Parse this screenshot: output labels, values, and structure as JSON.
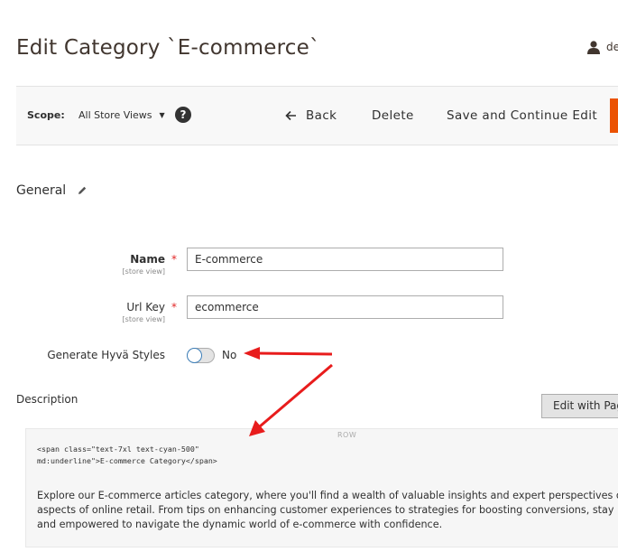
{
  "header": {
    "title": "Edit Category `E-commerce`",
    "user": "de"
  },
  "toolbar": {
    "scope_label": "Scope:",
    "scope_value": "All Store Views",
    "help": "?",
    "back": "Back",
    "delete": "Delete",
    "save_continue": "Save and Continue Edit"
  },
  "section": {
    "title": "General"
  },
  "fields": {
    "name": {
      "label": "Name",
      "scope": "[store view]",
      "value": "E-commerce"
    },
    "url_key": {
      "label": "Url Key",
      "scope": "[store view]",
      "value": "ecommerce"
    },
    "generate_hyva": {
      "label": "Generate Hyvä Styles",
      "state": "No"
    }
  },
  "description": {
    "label": "Description",
    "edit_button": "Edit with Page Builder",
    "row_tag": "ROW",
    "code_line1": "<span class=\"text-7xl text-cyan-500\"",
    "code_line2": "md:underline\">E-commerce Category</span>",
    "text_line1": "Explore our E-commerce articles category, where you'll find a wealth of valuable insights and expert perspectives on various",
    "text_line2": "aspects of online retail. From tips on enhancing customer experiences to strategies for boosting conversions, stay informed",
    "text_line3": "and empowered to navigate the dynamic world of e-commerce with confidence."
  },
  "colors": {
    "accent": "#eb5202",
    "arrow": "#e81c1c",
    "toggle_border": "#3d7fb9"
  }
}
